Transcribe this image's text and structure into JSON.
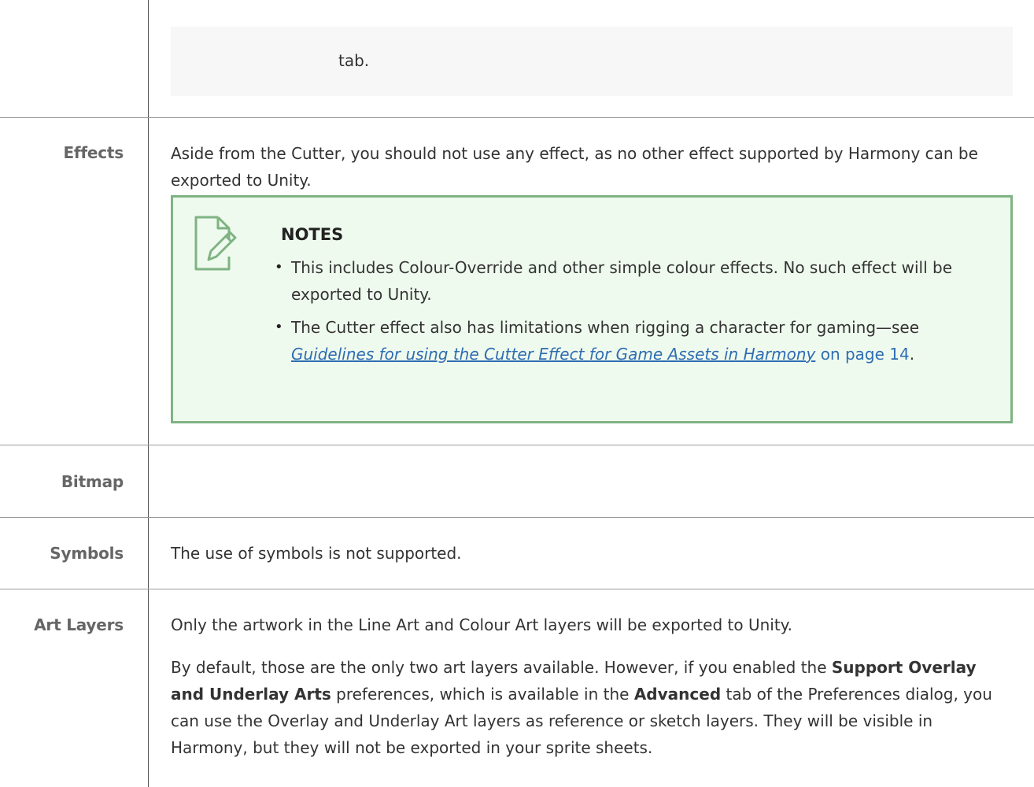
{
  "top_box": {
    "text": "tab."
  },
  "rows": {
    "effects": {
      "label": "Effects",
      "text": "Aside from the Cutter, you should not use any effect, as no other effect supported by Harmony can be exported to Unity."
    },
    "note": {
      "title": "NOTES",
      "icon": "note-pencil-icon",
      "items": [
        "This includes Colour-Override and other simple colour effects. No such effect will be exported to Unity.",
        "The Cutter effect also has limitations when rigging a character for gaming—see "
      ],
      "link_text": "Guidelines for using the Cutter Effect for Game Assets in Harmony",
      "page_ref": "on page 14",
      "end_punct": "."
    },
    "bitmap": {
      "label": "Bitmap"
    },
    "symbols": {
      "label": "Symbols",
      "text": "The use of symbols is not supported."
    },
    "art_layers": {
      "label": "Art Layers",
      "para1": "Only the artwork in the Line Art and Colour Art layers will be exported to Unity.",
      "para2": {
        "t1": "By default, those are the only two art layers available. However, if you enabled the ",
        "b1": "Support Overlay and Underlay Arts",
        "t2": " preferences, which is available in the ",
        "b2": "Advanced",
        "t3": " tab of the Preferences dialog, you can use the Overlay and Underlay Art layers as reference or sketch layers. They will be visible in Harmony, but they will not be exported in your sprite sheets."
      }
    }
  },
  "colors": {
    "note_border": "#7fb383",
    "note_bg": "#effaee",
    "link": "#2f6db3"
  }
}
